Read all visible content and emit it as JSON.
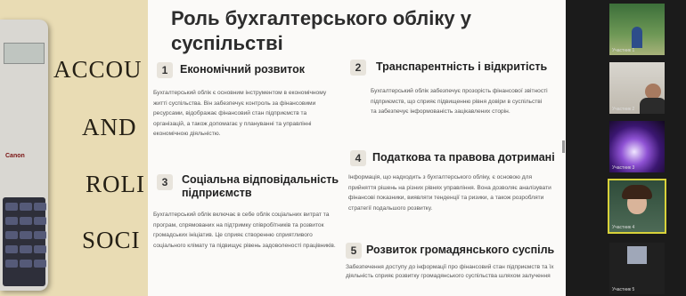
{
  "left_panel": {
    "words": [
      "ACCOU",
      "AND",
      "ROLI",
      "SOCI"
    ],
    "calculator_brand": "Canon"
  },
  "slide": {
    "title": "Роль бухгалтерського обліку у суспільстві",
    "sections": [
      {
        "num": "1",
        "title": "Економічний розвиток",
        "body": "Бухгалтерський облік є основним інструментом в економічному житті суспільства. Він забезпечує контроль за фінансовими ресурсами, відображає фінансовий стан підприємств та організацій, а також допомагає у плануванні та управлінні економічною діяльністю."
      },
      {
        "num": "2",
        "title": "Транспарентність і відкритість",
        "body": "Бухгалтерський облік забезпечує прозорість фінансової звітності підприємств, що сприяє підвищенню рівня довіри в суспільстві та забезпечує інформованість зацікавлених сторін."
      },
      {
        "num": "3",
        "title": "Соціальна відповідальність підприємств",
        "body": "Бухгалтерський облік включає в себе облік соціальних витрат та програм, спрямованих на підтримку співробітників та розвиток громадських ініціатив. Це сприяє створенню сприятливого соціального клімату та підвищує рівень задоволеності працівників."
      },
      {
        "num": "4",
        "title": "Податкова та правова дотримані",
        "body": "Інформація, що надходить з бухгалтерського обліку, є основою для прийняття рішень на різних рівнях управління. Вона дозволяє аналізувати фінансові показники, виявляти тенденції та ризики, а також розробляти стратегії подальшого розвитку."
      },
      {
        "num": "5",
        "title": "Розвиток громадянського суспіль",
        "body": "Забезпечення доступу до інформації про фінансовий стан підприємств та їх діяльність сприяє розвитку громадянського суспільства шляхом залучення"
      }
    ]
  },
  "participants": [
    {
      "name": "Участник 1",
      "active": false
    },
    {
      "name": "Участник 2",
      "active": false
    },
    {
      "name": "Участник 3",
      "active": false
    },
    {
      "name": "Участник 4",
      "active": true
    },
    {
      "name": "Участник 5",
      "active": false
    }
  ],
  "colors": {
    "accent_border": "#d8d23a",
    "slide_bg": "#fbfaf8",
    "panel_bg": "#e9dcb4"
  }
}
